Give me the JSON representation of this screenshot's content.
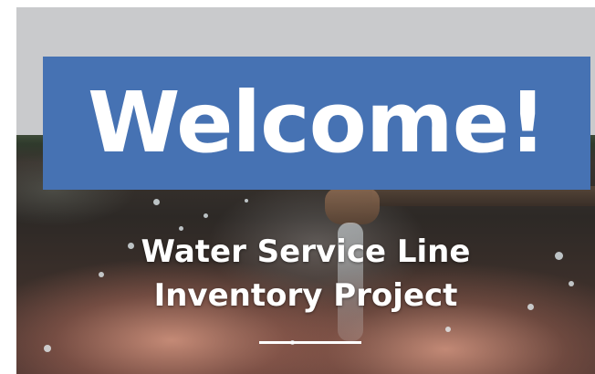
{
  "hero": {
    "welcome": "Welcome!",
    "subtitle_line1": "Water Service Line",
    "subtitle_line2": "Inventory Project"
  },
  "colors": {
    "banner": "#4672b3",
    "top_band": "#c9cacc",
    "text": "#ffffff"
  },
  "imagery": {
    "background": "hands-under-running-faucet-photo"
  }
}
